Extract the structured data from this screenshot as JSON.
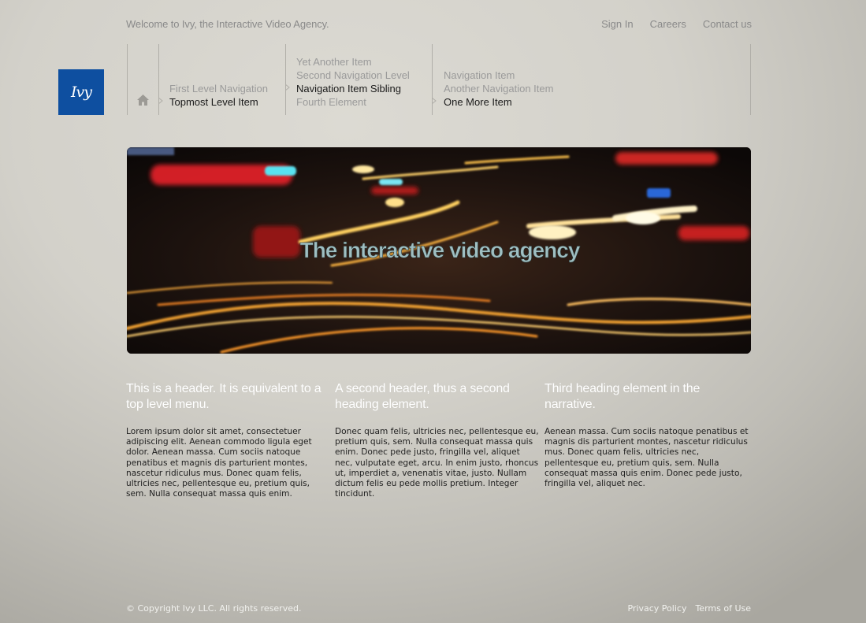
{
  "header": {
    "tagline": "Welcome to Ivy, the Interactive Video Agency.",
    "links": [
      "Sign In",
      "Careers",
      "Contact us"
    ]
  },
  "logo": {
    "text": "Ivy",
    "color": "#0e4fa0"
  },
  "nav": {
    "home_icon": "home-icon",
    "columns": [
      {
        "items": [
          {
            "label": "First Level Navigation",
            "active": false
          },
          {
            "label": "Topmost Level Item",
            "active": true
          }
        ]
      },
      {
        "items": [
          {
            "label": "Yet Another Item",
            "active": false
          },
          {
            "label": "Second Navigation Level",
            "active": false
          },
          {
            "label": "Navigation Item Sibling",
            "active": true
          },
          {
            "label": "Fourth Element",
            "active": false
          }
        ]
      },
      {
        "items": [
          {
            "label": "Navigation Item",
            "active": false
          },
          {
            "label": "Another Navigation Item",
            "active": false
          },
          {
            "label": "One More Item",
            "active": true
          }
        ]
      }
    ]
  },
  "hero": {
    "headline": "The interactive video agency"
  },
  "columns": [
    {
      "heading": "This is a header. It is equivalent to a top level menu.",
      "body": "Lorem ipsum dolor sit amet, consectetuer adipiscing elit. Aenean commodo ligula eget dolor. Aenean massa. Cum sociis natoque penatibus et magnis dis parturient montes, nascetur ridiculus mus. Donec quam felis, ultricies nec, pellentesque eu, pretium quis, sem. Nulla consequat massa quis enim."
    },
    {
      "heading": "A second header, thus a second heading element.",
      "body": "Donec quam felis, ultricies nec, pellentesque eu, pretium quis, sem. Nulla consequat massa quis enim. Donec pede justo, fringilla vel, aliquet nec, vulputate eget, arcu. In enim justo, rhoncus ut, imperdiet a, venenatis vitae, justo. Nullam dictum felis eu pede mollis pretium. Integer tincidunt."
    },
    {
      "heading": "Third heading element in the narrative.",
      "body": "Aenean massa. Cum sociis natoque penatibus et magnis dis parturient montes, nascetur ridiculus mus. Donec quam felis, ultricies nec, pellentesque eu, pretium quis, sem. Nulla consequat massa quis enim. Donec pede justo, fringilla vel, aliquet nec."
    }
  ],
  "footer": {
    "copyright": "© Copyright Ivy LLC. All rights reserved.",
    "links": [
      "Privacy Policy",
      "Terms of Use"
    ]
  }
}
